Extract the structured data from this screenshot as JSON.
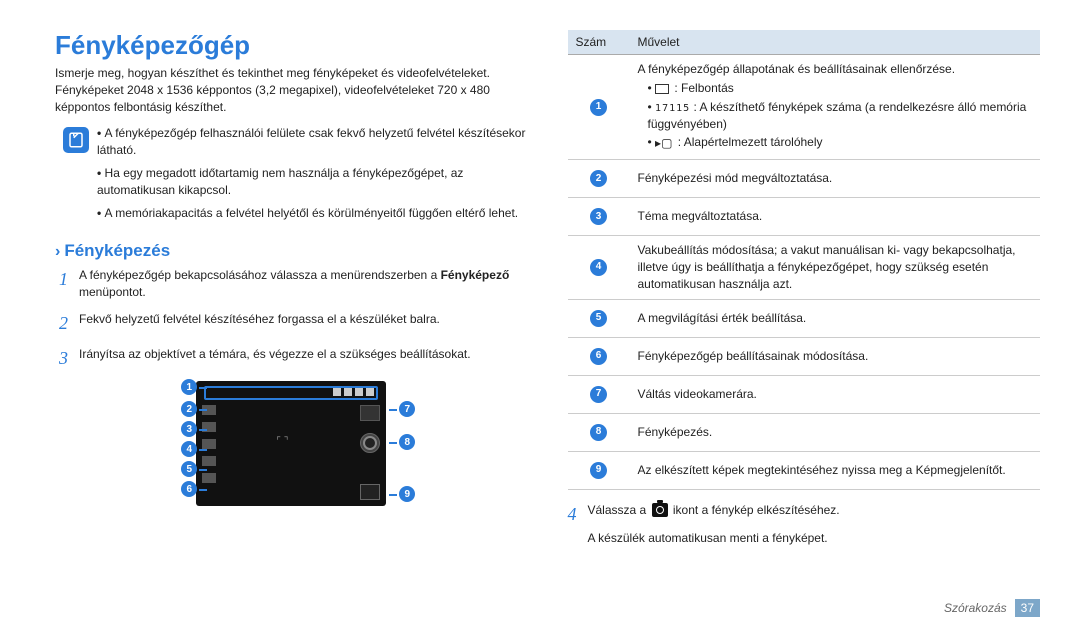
{
  "title": "Fényképezőgép",
  "intro": "Ismerje meg, hogyan készíthet és tekinthet meg fényképeket és videofelvételeket. Fényképeket 2048 x 1536 képpontos (3,2 megapixel), videofelvételeket 720 x 480 képpontos felbontásig készíthet.",
  "notes": [
    "A fényképezőgép felhasználói felülete csak fekvő helyzetű felvétel készítésekor látható.",
    "Ha egy megadott időtartamig nem használja a fényképezőgépet, az automatikusan kikapcsol.",
    "A memóriakapacitás a felvétel helyétől és körülményeitől függően eltérő lehet."
  ],
  "section": "Fényképezés",
  "step1": {
    "pre": "A fényképezőgép bekapcsolásához válassza a menürendszerben a ",
    "bold": "Fényképező",
    "post": " menüpontot."
  },
  "step2": "Fekvő helyzetű felvétel készítéséhez forgassa el a készüléket balra.",
  "step3": "Irányítsa az objektívet a témára, és végezze el a szükséges beállításokat.",
  "table_hdr": {
    "num": "Szám",
    "op": "Művelet"
  },
  "ops": {
    "r1": {
      "main": "A fényképezőgép állapotának és beállításainak ellenőrzése.",
      "a_label": " : Felbontás",
      "b_pre": " : A készíthető fényképek száma (a rendelkezésre álló memória függvényében)",
      "b_count": "17115",
      "c_label": " : Alapértelmezett tárolóhely"
    },
    "r2": "Fényképezési mód megváltoztatása.",
    "r3": "Téma megváltoztatása.",
    "r4": "Vakubeállítás módosítása; a vakut manuálisan ki- vagy bekapcsolhatja, illetve úgy is beállíthatja a fényképezőgépet, hogy szükség esetén automatikusan használja azt.",
    "r5": "A megvilágítási érték beállítása.",
    "r6": "Fényképezőgép beállításainak módosítása.",
    "r7": "Váltás videokamerára.",
    "r8": "Fényképezés.",
    "r9": "Az elkészített képek megtekintéséhez nyissa meg a Képmegjelenítőt."
  },
  "step4_pre": "Válassza a ",
  "step4_post": " ikont a fénykép elkészítéséhez.",
  "after4": "A készülék automatikusan menti a fényképet.",
  "footer_section": "Szórakozás",
  "footer_page": "37"
}
